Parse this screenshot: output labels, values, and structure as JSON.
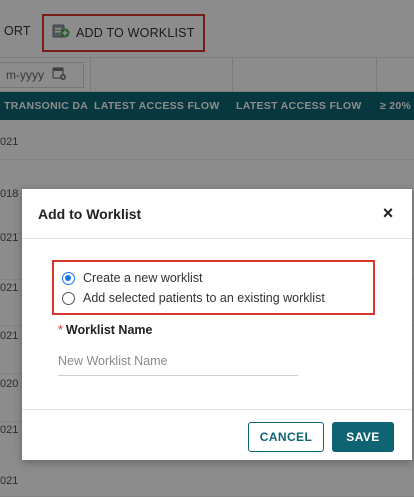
{
  "toolbar": {
    "export_label": "ORT",
    "add_to_worklist_label": "ADD TO WORKLIST"
  },
  "filters": {
    "date_placeholder": "m-yyyy"
  },
  "table": {
    "headers": [
      "TRANSONIC DA",
      "LATEST ACCESS FLOW",
      "LATEST ACCESS FLOW",
      "≥ 20%"
    ],
    "rows": [
      "021",
      "018",
      "021",
      "021",
      "021",
      "020",
      "021",
      "021",
      "021"
    ]
  },
  "modal": {
    "title": "Add to Worklist",
    "close_symbol": "×",
    "options": [
      {
        "label": "Create a new worklist",
        "checked": true
      },
      {
        "label": "Add selected patients to an existing worklist",
        "checked": false
      }
    ],
    "required_mark": "*",
    "field_label": "Worklist Name",
    "field_value": "",
    "field_placeholder": "New Worklist Name",
    "cancel_label": "CANCEL",
    "save_label": "SAVE"
  },
  "colors": {
    "primary": "#0e6473",
    "highlight": "#d9342b",
    "radio_selected": "#1a73e8"
  },
  "icons": [
    "add-to-worklist-icon",
    "calendar-clear-icon",
    "close-icon"
  ]
}
